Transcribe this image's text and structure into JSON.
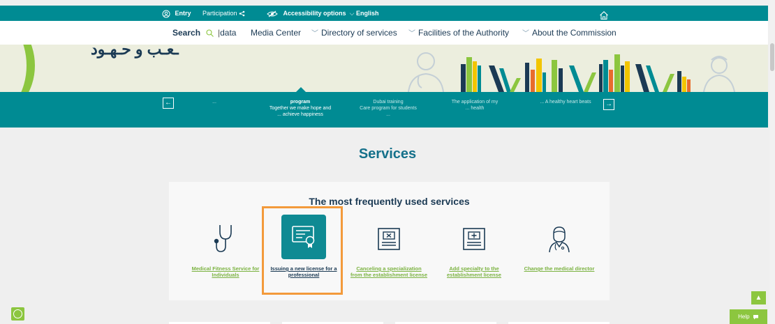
{
  "topbar": {
    "entry": "Entry",
    "participation": "Participation",
    "accessibility": "Accessibility options",
    "language": "English",
    "home_icon": "home-icon"
  },
  "nav": {
    "search": "Search",
    "data": "data",
    "media_center": "Media Center",
    "directory": "Directory of services",
    "facilities": "Facilities of the Authority",
    "about": "About the Commission"
  },
  "banner": {
    "arabic_text": "ـعـب و حـهـود"
  },
  "carousel": {
    "prev": "←",
    "next": "→",
    "dots": "...",
    "slides": [
      {
        "title": "program",
        "line1": "Together we make hope and",
        "line2": "... achieve happiness"
      },
      {
        "title": "",
        "line1": "Dubai training",
        "line2": "Care program for students",
        "line3": "..."
      },
      {
        "title": "",
        "line1": "The application of my",
        "line2": "... health"
      },
      {
        "title": "",
        "line1": "... A healthy heart beats"
      }
    ]
  },
  "services": {
    "title": "Services",
    "frequent_title": "The most frequently used services",
    "items": [
      {
        "label": "Medical Fitness Service for Individuals",
        "icon": "stethoscope-icon"
      },
      {
        "label": "Issuing a new license for a professional",
        "icon": "license-certificate-icon"
      },
      {
        "label": "Canceling a specialization from the establishment license",
        "icon": "cancel-document-icon"
      },
      {
        "label": "Add specialty to the establishment license",
        "icon": "add-document-icon"
      },
      {
        "label": "Change the medical director",
        "icon": "doctor-icon"
      }
    ]
  },
  "floating": {
    "up": "▲",
    "help": "Help"
  },
  "colors": {
    "teal": "#008b93",
    "green": "#8cc63f",
    "navy": "#1b3a54",
    "highlight": "#f39a3b"
  }
}
